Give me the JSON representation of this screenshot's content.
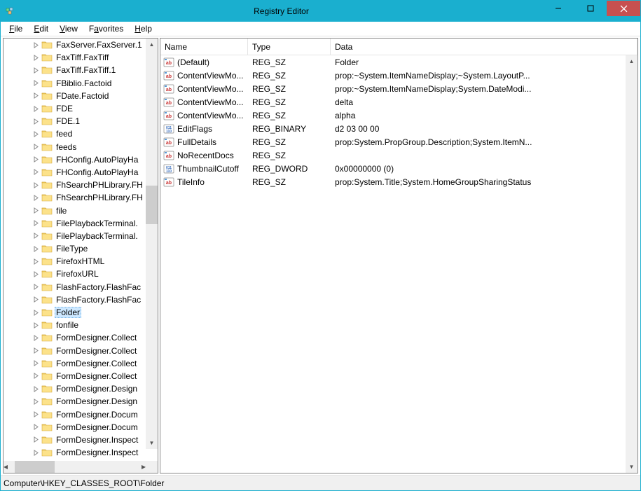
{
  "window": {
    "title": "Registry Editor",
    "controls": {
      "min": "—",
      "max": "▢",
      "close": "✕"
    }
  },
  "menu": {
    "file": {
      "label": "File",
      "u": "F"
    },
    "edit": {
      "label": "Edit",
      "u": "E"
    },
    "view": {
      "label": "View",
      "u": "V"
    },
    "favorites": {
      "label": "Favorites",
      "u": "a"
    },
    "help": {
      "label": "Help",
      "u": "H"
    }
  },
  "tree": {
    "items": [
      {
        "label": "FaxServer.FaxServer.1",
        "selected": false
      },
      {
        "label": "FaxTiff.FaxTiff",
        "selected": false
      },
      {
        "label": "FaxTiff.FaxTiff.1",
        "selected": false
      },
      {
        "label": "FBiblio.Factoid",
        "selected": false
      },
      {
        "label": "FDate.Factoid",
        "selected": false
      },
      {
        "label": "FDE",
        "selected": false
      },
      {
        "label": "FDE.1",
        "selected": false
      },
      {
        "label": "feed",
        "selected": false
      },
      {
        "label": "feeds",
        "selected": false
      },
      {
        "label": "FHConfig.AutoPlayHa",
        "selected": false
      },
      {
        "label": "FHConfig.AutoPlayHa",
        "selected": false
      },
      {
        "label": "FhSearchPHLibrary.FH",
        "selected": false
      },
      {
        "label": "FhSearchPHLibrary.FH",
        "selected": false
      },
      {
        "label": "file",
        "selected": false
      },
      {
        "label": "FilePlaybackTerminal.",
        "selected": false
      },
      {
        "label": "FilePlaybackTerminal.",
        "selected": false
      },
      {
        "label": "FileType",
        "selected": false
      },
      {
        "label": "FirefoxHTML",
        "selected": false
      },
      {
        "label": "FirefoxURL",
        "selected": false
      },
      {
        "label": "FlashFactory.FlashFac",
        "selected": false
      },
      {
        "label": "FlashFactory.FlashFac",
        "selected": false
      },
      {
        "label": "Folder",
        "selected": true
      },
      {
        "label": "fonfile",
        "selected": false
      },
      {
        "label": "FormDesigner.Collect",
        "selected": false
      },
      {
        "label": "FormDesigner.Collect",
        "selected": false
      },
      {
        "label": "FormDesigner.Collect",
        "selected": false
      },
      {
        "label": "FormDesigner.Collect",
        "selected": false
      },
      {
        "label": "FormDesigner.Design",
        "selected": false
      },
      {
        "label": "FormDesigner.Design",
        "selected": false
      },
      {
        "label": "FormDesigner.Docum",
        "selected": false
      },
      {
        "label": "FormDesigner.Docum",
        "selected": false
      },
      {
        "label": "FormDesigner.Inspect",
        "selected": false
      },
      {
        "label": "FormDesigner.Inspect",
        "selected": false
      }
    ]
  },
  "list": {
    "columns": {
      "name": "Name",
      "type": "Type",
      "data": "Data"
    },
    "rows": [
      {
        "icon": "sz",
        "name": "(Default)",
        "type": "REG_SZ",
        "data": "Folder"
      },
      {
        "icon": "sz",
        "name": "ContentViewMo...",
        "type": "REG_SZ",
        "data": "prop:~System.ItemNameDisplay;~System.LayoutP..."
      },
      {
        "icon": "sz",
        "name": "ContentViewMo...",
        "type": "REG_SZ",
        "data": "prop:~System.ItemNameDisplay;System.DateModi..."
      },
      {
        "icon": "sz",
        "name": "ContentViewMo...",
        "type": "REG_SZ",
        "data": "delta"
      },
      {
        "icon": "sz",
        "name": "ContentViewMo...",
        "type": "REG_SZ",
        "data": "alpha"
      },
      {
        "icon": "bin",
        "name": "EditFlags",
        "type": "REG_BINARY",
        "data": "d2 03 00 00"
      },
      {
        "icon": "sz",
        "name": "FullDetails",
        "type": "REG_SZ",
        "data": "prop:System.PropGroup.Description;System.ItemN..."
      },
      {
        "icon": "sz",
        "name": "NoRecentDocs",
        "type": "REG_SZ",
        "data": ""
      },
      {
        "icon": "bin",
        "name": "ThumbnailCutoff",
        "type": "REG_DWORD",
        "data": "0x00000000 (0)"
      },
      {
        "icon": "sz",
        "name": "TileInfo",
        "type": "REG_SZ",
        "data": "prop:System.Title;System.HomeGroupSharingStatus"
      }
    ]
  },
  "statusbar": {
    "path": "Computer\\HKEY_CLASSES_ROOT\\Folder"
  }
}
